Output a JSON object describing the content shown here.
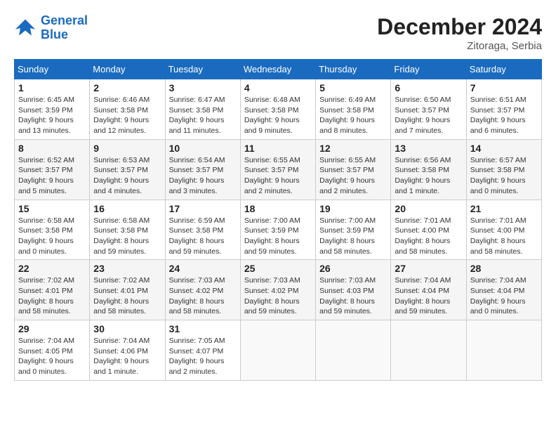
{
  "header": {
    "logo_line1": "General",
    "logo_line2": "Blue",
    "month": "December 2024",
    "location": "Zitoraga, Serbia"
  },
  "weekdays": [
    "Sunday",
    "Monday",
    "Tuesday",
    "Wednesday",
    "Thursday",
    "Friday",
    "Saturday"
  ],
  "weeks": [
    [
      {
        "day": "1",
        "sunrise": "6:45 AM",
        "sunset": "3:59 PM",
        "daylight": "9 hours and 13 minutes."
      },
      {
        "day": "2",
        "sunrise": "6:46 AM",
        "sunset": "3:58 PM",
        "daylight": "9 hours and 12 minutes."
      },
      {
        "day": "3",
        "sunrise": "6:47 AM",
        "sunset": "3:58 PM",
        "daylight": "9 hours and 11 minutes."
      },
      {
        "day": "4",
        "sunrise": "6:48 AM",
        "sunset": "3:58 PM",
        "daylight": "9 hours and 9 minutes."
      },
      {
        "day": "5",
        "sunrise": "6:49 AM",
        "sunset": "3:58 PM",
        "daylight": "9 hours and 8 minutes."
      },
      {
        "day": "6",
        "sunrise": "6:50 AM",
        "sunset": "3:57 PM",
        "daylight": "9 hours and 7 minutes."
      },
      {
        "day": "7",
        "sunrise": "6:51 AM",
        "sunset": "3:57 PM",
        "daylight": "9 hours and 6 minutes."
      }
    ],
    [
      {
        "day": "8",
        "sunrise": "6:52 AM",
        "sunset": "3:57 PM",
        "daylight": "9 hours and 5 minutes."
      },
      {
        "day": "9",
        "sunrise": "6:53 AM",
        "sunset": "3:57 PM",
        "daylight": "9 hours and 4 minutes."
      },
      {
        "day": "10",
        "sunrise": "6:54 AM",
        "sunset": "3:57 PM",
        "daylight": "9 hours and 3 minutes."
      },
      {
        "day": "11",
        "sunrise": "6:55 AM",
        "sunset": "3:57 PM",
        "daylight": "9 hours and 2 minutes."
      },
      {
        "day": "12",
        "sunrise": "6:55 AM",
        "sunset": "3:57 PM",
        "daylight": "9 hours and 2 minutes."
      },
      {
        "day": "13",
        "sunrise": "6:56 AM",
        "sunset": "3:58 PM",
        "daylight": "9 hours and 1 minute."
      },
      {
        "day": "14",
        "sunrise": "6:57 AM",
        "sunset": "3:58 PM",
        "daylight": "9 hours and 0 minutes."
      }
    ],
    [
      {
        "day": "15",
        "sunrise": "6:58 AM",
        "sunset": "3:58 PM",
        "daylight": "9 hours and 0 minutes."
      },
      {
        "day": "16",
        "sunrise": "6:58 AM",
        "sunset": "3:58 PM",
        "daylight": "8 hours and 59 minutes."
      },
      {
        "day": "17",
        "sunrise": "6:59 AM",
        "sunset": "3:58 PM",
        "daylight": "8 hours and 59 minutes."
      },
      {
        "day": "18",
        "sunrise": "7:00 AM",
        "sunset": "3:59 PM",
        "daylight": "8 hours and 59 minutes."
      },
      {
        "day": "19",
        "sunrise": "7:00 AM",
        "sunset": "3:59 PM",
        "daylight": "8 hours and 58 minutes."
      },
      {
        "day": "20",
        "sunrise": "7:01 AM",
        "sunset": "4:00 PM",
        "daylight": "8 hours and 58 minutes."
      },
      {
        "day": "21",
        "sunrise": "7:01 AM",
        "sunset": "4:00 PM",
        "daylight": "8 hours and 58 minutes."
      }
    ],
    [
      {
        "day": "22",
        "sunrise": "7:02 AM",
        "sunset": "4:01 PM",
        "daylight": "8 hours and 58 minutes."
      },
      {
        "day": "23",
        "sunrise": "7:02 AM",
        "sunset": "4:01 PM",
        "daylight": "8 hours and 58 minutes."
      },
      {
        "day": "24",
        "sunrise": "7:03 AM",
        "sunset": "4:02 PM",
        "daylight": "8 hours and 58 minutes."
      },
      {
        "day": "25",
        "sunrise": "7:03 AM",
        "sunset": "4:02 PM",
        "daylight": "8 hours and 59 minutes."
      },
      {
        "day": "26",
        "sunrise": "7:03 AM",
        "sunset": "4:03 PM",
        "daylight": "8 hours and 59 minutes."
      },
      {
        "day": "27",
        "sunrise": "7:04 AM",
        "sunset": "4:04 PM",
        "daylight": "8 hours and 59 minutes."
      },
      {
        "day": "28",
        "sunrise": "7:04 AM",
        "sunset": "4:04 PM",
        "daylight": "9 hours and 0 minutes."
      }
    ],
    [
      {
        "day": "29",
        "sunrise": "7:04 AM",
        "sunset": "4:05 PM",
        "daylight": "9 hours and 0 minutes."
      },
      {
        "day": "30",
        "sunrise": "7:04 AM",
        "sunset": "4:06 PM",
        "daylight": "9 hours and 1 minute."
      },
      {
        "day": "31",
        "sunrise": "7:05 AM",
        "sunset": "4:07 PM",
        "daylight": "9 hours and 2 minutes."
      },
      null,
      null,
      null,
      null
    ]
  ]
}
